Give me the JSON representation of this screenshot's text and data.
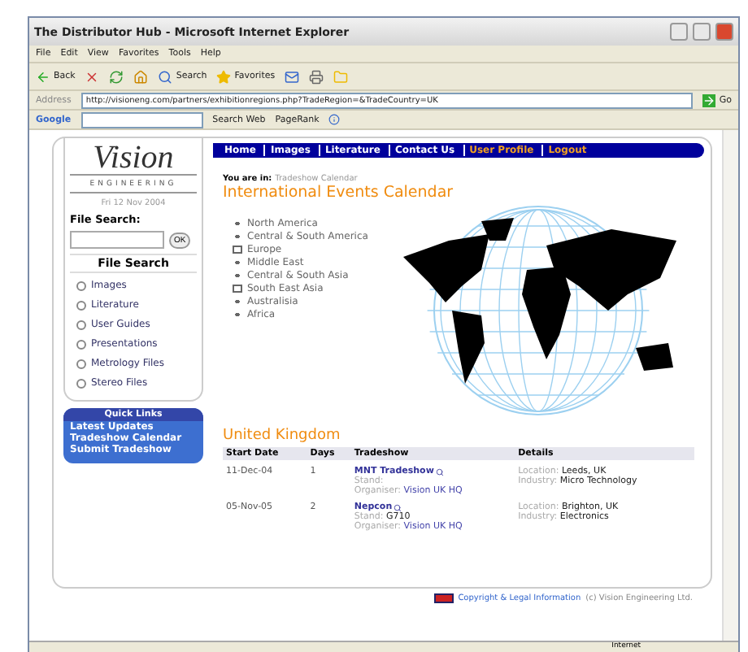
{
  "window": {
    "title": "The Distributor Hub - Microsoft Internet Explorer"
  },
  "menu": [
    "File",
    "Edit",
    "View",
    "Favorites",
    "Tools",
    "Help"
  ],
  "toolbar": {
    "back": "Back",
    "search": "Search",
    "favorites": "Favorites"
  },
  "address": {
    "label": "Address",
    "url": "http://visioneng.com/partners/exhibitionregions.php?TradeRegion=&TradeCountry=UK",
    "go": "Go"
  },
  "google_bar": {
    "logo": "Google",
    "search_web": "Search Web",
    "pagerank": "PageRank"
  },
  "sidebar": {
    "logo": "Vision",
    "logo_sub": "ENGINEERING",
    "date": "Fri 12 Nov 2004",
    "file_search_label": "File Search:",
    "ok": "OK",
    "file_search_title": "File Search",
    "links": [
      "Images",
      "Literature",
      "User Guides",
      "Presentations",
      "Metrology Files",
      "Stereo Files"
    ],
    "quick_links": {
      "title": "Quick Links",
      "items": [
        "Latest Updates",
        "Tradeshow Calendar",
        "Submit Tradeshow"
      ]
    }
  },
  "nav": [
    {
      "label": "Home",
      "highlighted": false
    },
    {
      "label": "Images",
      "highlighted": false
    },
    {
      "label": "Literature",
      "highlighted": false
    },
    {
      "label": "Contact Us",
      "highlighted": false
    },
    {
      "label": "User Profile",
      "highlighted": true
    },
    {
      "label": "Logout",
      "highlighted": true
    }
  ],
  "breadcrumb": {
    "label": "You are in:",
    "page": "Tradeshow Calendar"
  },
  "heading": "International Events Calendar",
  "regions": [
    {
      "label": "North America",
      "kind": "bullet"
    },
    {
      "label": "Central & South America",
      "kind": "bullet"
    },
    {
      "label": "Europe",
      "kind": "folder"
    },
    {
      "label": "Middle East",
      "kind": "bullet"
    },
    {
      "label": "Central & South Asia",
      "kind": "bullet"
    },
    {
      "label": "South East Asia",
      "kind": "folder"
    },
    {
      "label": "Australisia",
      "kind": "bullet"
    },
    {
      "label": "Africa",
      "kind": "bullet"
    }
  ],
  "country": "United Kingdom",
  "table": {
    "columns": [
      "Start Date",
      "Days",
      "Tradeshow",
      "Details"
    ],
    "rows": [
      {
        "start": "11-Dec-04",
        "days": "1",
        "name": "MNT Tradeshow",
        "stand_label": "Stand:",
        "stand": "",
        "organiser_label": "Organiser:",
        "organiser": "Vision UK HQ",
        "location_label": "Location:",
        "location": "Leeds, UK",
        "industry_label": "Industry:",
        "industry": "Micro Technology"
      },
      {
        "start": "05-Nov-05",
        "days": "2",
        "name": "Nepcon",
        "stand_label": "Stand:",
        "stand": "G710",
        "organiser_label": "Organiser:",
        "organiser": "Vision UK HQ",
        "location_label": "Location:",
        "location": "Brighton, UK",
        "industry_label": "Industry:",
        "industry": "Electronics"
      }
    ]
  },
  "footer": {
    "link": "Copyright & Legal Information",
    "text": "(c) Vision Engineering Ltd."
  },
  "status_bar": {
    "zone": "Internet"
  }
}
